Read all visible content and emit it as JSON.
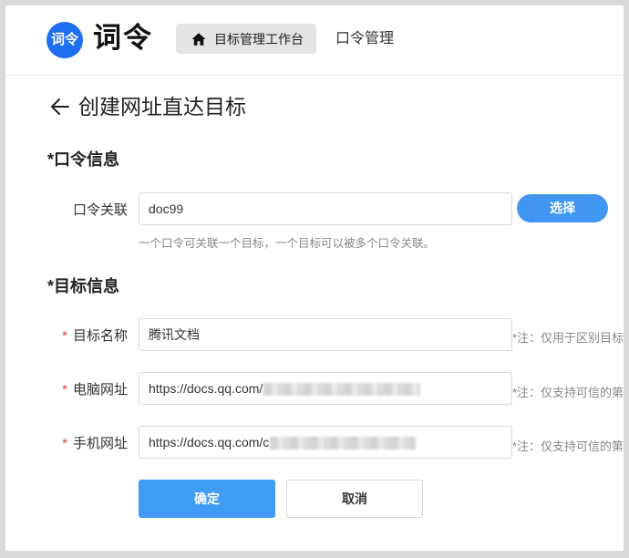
{
  "header": {
    "logo_badge": "词令",
    "logo_text": "词令",
    "nav": {
      "active_label": "目标管理工作台",
      "active_icon": "home-icon",
      "second_label": "口令管理"
    }
  },
  "page": {
    "title": "创建网址直达目标",
    "back_icon": "arrow-left-icon"
  },
  "keyword_section": {
    "title": "*口令信息",
    "label": "口令关联",
    "value": "doc99",
    "select_button": "选择",
    "hint": "一个口令可关联一个目标，一个目标可以被多个口令关联。"
  },
  "target_section": {
    "title": "*目标信息",
    "required_mark": "*",
    "name": {
      "label": "目标名称",
      "value": "腾讯文档",
      "note": "*注：仅用于区别目标"
    },
    "pc_url": {
      "label": "电脑网址",
      "value": "https://docs.qq.com/",
      "note": "*注：仅支持可信的第"
    },
    "mobile_url": {
      "label": "手机网址",
      "value": "https://docs.qq.com/c",
      "note": "*注：仅支持可信的第"
    }
  },
  "actions": {
    "confirm": "确定",
    "cancel": "取消"
  },
  "colors": {
    "brand_blue": "#1f6ff2",
    "primary_button": "#3f9bf5",
    "select_button": "#4196f2",
    "required": "#e2403b"
  }
}
